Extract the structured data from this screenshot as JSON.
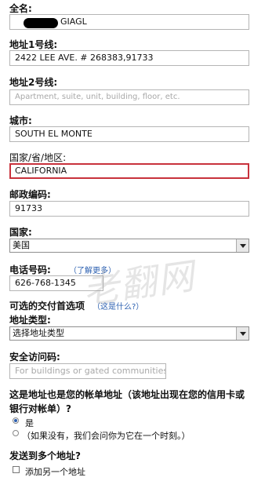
{
  "fields": {
    "full_name": {
      "label": "全名:",
      "value": "GIAGL"
    },
    "address1": {
      "label": "地址1号线:",
      "value": "2422 LEE AVE. # 268383,91733"
    },
    "address2": {
      "label": "地址2号线:",
      "placeholder": "Apartment, suite, unit, building, floor, etc."
    },
    "city": {
      "label": "城市:",
      "value": "SOUTH EL MONTE"
    },
    "state": {
      "label": "国家/省/地区:",
      "value": "CALIFORNIA"
    },
    "zip": {
      "label": "邮政编码:",
      "value": "91733"
    },
    "country": {
      "label": "国家:",
      "value": "美国"
    },
    "phone": {
      "label": "电话号码:",
      "help": "（了解更多）",
      "value": "626-768-1345"
    }
  },
  "delivery_preferences": {
    "label": "可选的交付首选项",
    "help": "（这是什么?）"
  },
  "address_type": {
    "label": "地址类型:",
    "value": "选择地址类型"
  },
  "security_code": {
    "label": "安全访问码:",
    "placeholder": "For buildings or gated communities"
  },
  "billing": {
    "question": "这是地址也是您的帐单地址（该地址出现在您的信用卡或银行对帐单）?",
    "option_yes": "是",
    "option_no": "（如果没有，我们会问你为它在一个时刻。）"
  },
  "multi_ship": {
    "label": "发送到多个地址?",
    "checkbox_label": "添加另一个地址"
  },
  "watermark": "老翻网",
  "colors": {
    "error_border": "#c8323c",
    "link": "#2b5fb0"
  }
}
